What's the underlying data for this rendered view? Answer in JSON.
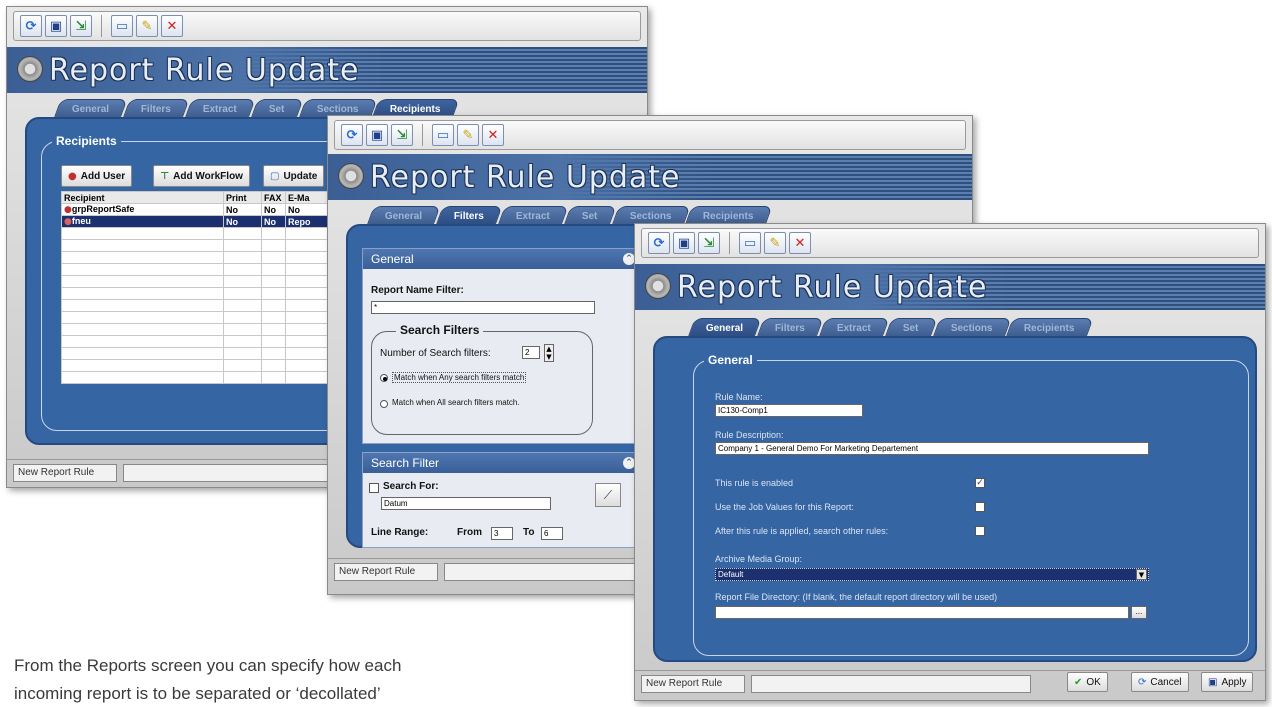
{
  "app": {
    "title": "Report Rule Update"
  },
  "toolbar": {
    "icons": [
      "refresh-icon",
      "save-icon",
      "export-icon",
      "new-document-icon",
      "edit-icon",
      "delete-icon"
    ]
  },
  "tabs": [
    "General",
    "Filters",
    "Extract",
    "Set",
    "Sections",
    "Recipients"
  ],
  "window1": {
    "group_title": "Recipients",
    "buttons": {
      "add_user": "Add User",
      "add_workflow": "Add WorkFlow",
      "update": "Update"
    },
    "columns": [
      "Recipient",
      "Print",
      "FAX",
      "E-Ma"
    ],
    "rows": [
      {
        "recipient": "grpReportSafe",
        "print": "No",
        "fax": "No",
        "email": "No"
      },
      {
        "recipient": "fneu",
        "print": "No",
        "fax": "No",
        "email": "Repo"
      }
    ],
    "status": "New Report Rule"
  },
  "window2": {
    "general_title": "General",
    "report_name_filter_label": "Report Name Filter:",
    "report_name_filter_value": "*",
    "search_filters_title": "Search Filters",
    "num_search_filters_label": "Number of Search filters:",
    "num_search_filters_value": "2",
    "match_any_label": "Match when Any search filters match",
    "match_all_label": "Match when All search filters match.",
    "search_filter_title": "Search Filter",
    "search_for_label": "Search For:",
    "search_for_value": "Datum",
    "line_range_label": "Line Range:",
    "from_label": "From",
    "from_value": "3",
    "to_label": "To",
    "to_value": "6",
    "status": "New Report Rule"
  },
  "window3": {
    "group_title": "General",
    "rule_name_label": "Rule Name:",
    "rule_name_value": "IC130-Comp1",
    "rule_description_label": "Rule Description:",
    "rule_description_value": "Company 1 - General Demo For Marketing Departement",
    "enabled_label": "This rule is enabled",
    "job_values_label": "Use the Job Values for this Report:",
    "search_other_label": "After this rule is applied, search other rules:",
    "archive_group_label": "Archive Media Group:",
    "archive_group_value": "Default",
    "report_dir_label": "Report File Directory:   (If blank, the default report directory will be used)",
    "report_dir_value": "",
    "status": "New Report Rule",
    "ok_label": "OK",
    "cancel_label": "Cancel",
    "apply_label": "Apply"
  },
  "caption": {
    "line1": "From the Reports screen you can specify how each",
    "line2": "incoming report is to be separated or ‘decollated’"
  }
}
